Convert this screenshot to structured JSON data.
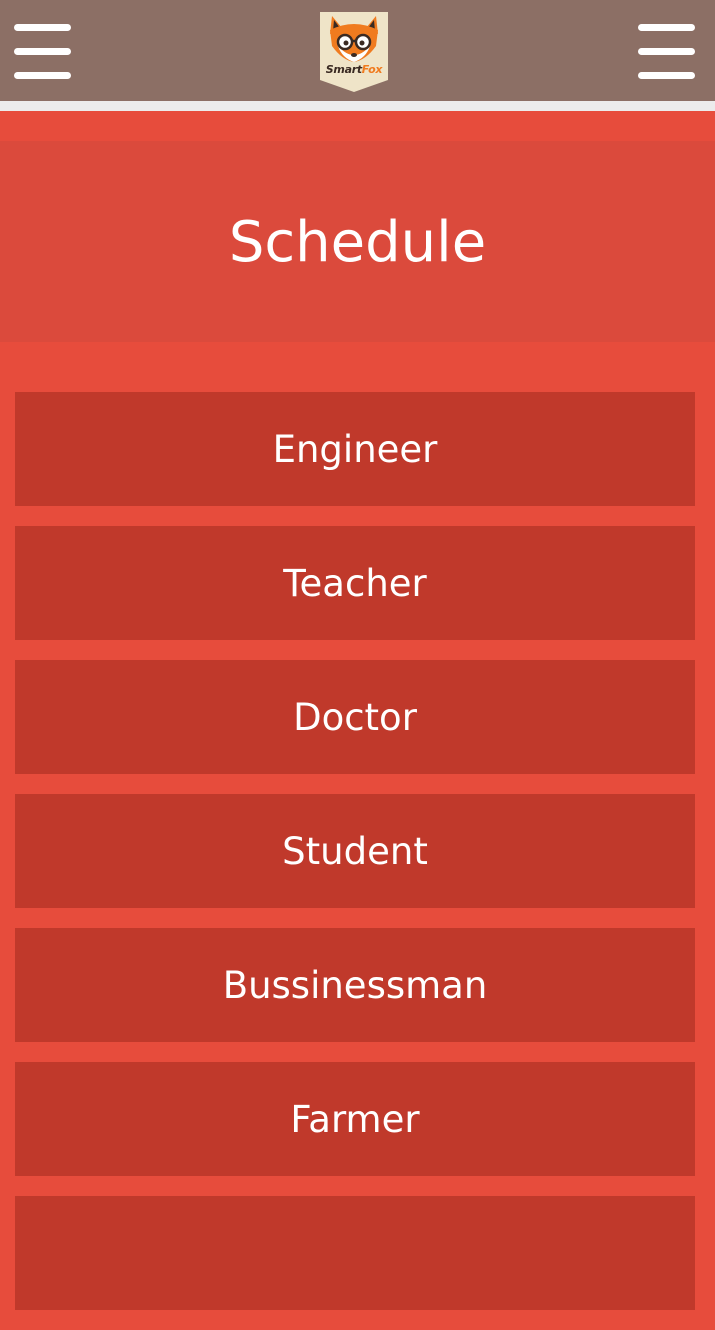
{
  "header": {
    "menu_left_icon": "hamburger-menu-icon",
    "menu_right_icon": "hamburger-menu-icon",
    "logo": {
      "text_part1": "Smart",
      "text_part2": "Fox",
      "icon": "fox-with-glasses-logo"
    }
  },
  "page": {
    "title": "Schedule"
  },
  "list": {
    "items": [
      {
        "label": "Engineer"
      },
      {
        "label": "Teacher"
      },
      {
        "label": "Doctor"
      },
      {
        "label": "Student"
      },
      {
        "label": "Bussinessman"
      },
      {
        "label": "Farmer"
      },
      {
        "label": ""
      }
    ]
  },
  "colors": {
    "topbar": "#8c6f65",
    "background": "#e74c3c",
    "header_band": "#db4a3c",
    "list_item": "#c0392b",
    "text": "#ffffff",
    "logo_accent": "#f07b1f"
  }
}
